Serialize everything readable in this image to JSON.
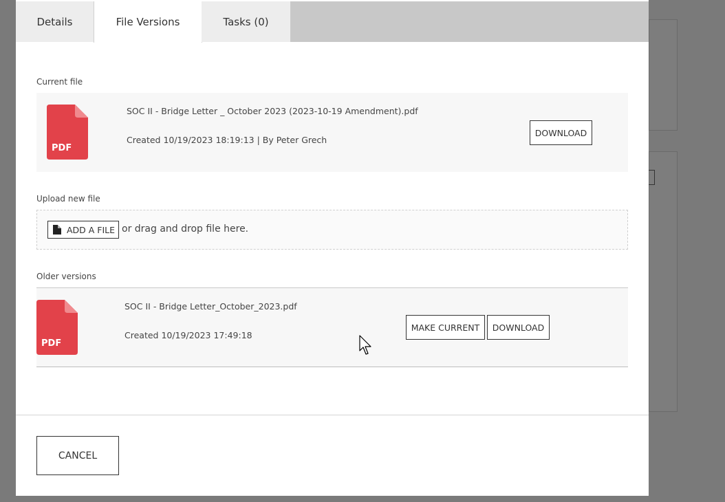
{
  "tabs": [
    {
      "label": "Details",
      "active": false
    },
    {
      "label": "File Versions",
      "active": true
    },
    {
      "label": "Tasks (0)",
      "active": false
    }
  ],
  "current_file": {
    "section_label": "Current file",
    "icon_label": "PDF",
    "filename": "SOC II - Bridge Letter _ October 2023 (2023-10-19 Amendment).pdf",
    "created": "Created 10/19/2023 18:19:13 | By Peter Grech",
    "download_label": "DOWNLOAD"
  },
  "upload": {
    "section_label": "Upload new file",
    "add_file_label": "ADD A FILE",
    "drop_text": "or drag and drop file here."
  },
  "older_versions": {
    "section_label": "Older versions",
    "items": [
      {
        "icon_label": "PDF",
        "filename": "SOC II - Bridge Letter_October_2023.pdf",
        "created": "Created 10/19/2023 17:49:18",
        "make_current_label": "MAKE CURRENT",
        "download_label": "DOWNLOAD"
      }
    ]
  },
  "footer": {
    "cancel_label": "CANCEL"
  },
  "colors": {
    "pdf_red": "#e2424a",
    "pdf_fold": "#f08a8e",
    "overlay": "#7a7a7a"
  }
}
